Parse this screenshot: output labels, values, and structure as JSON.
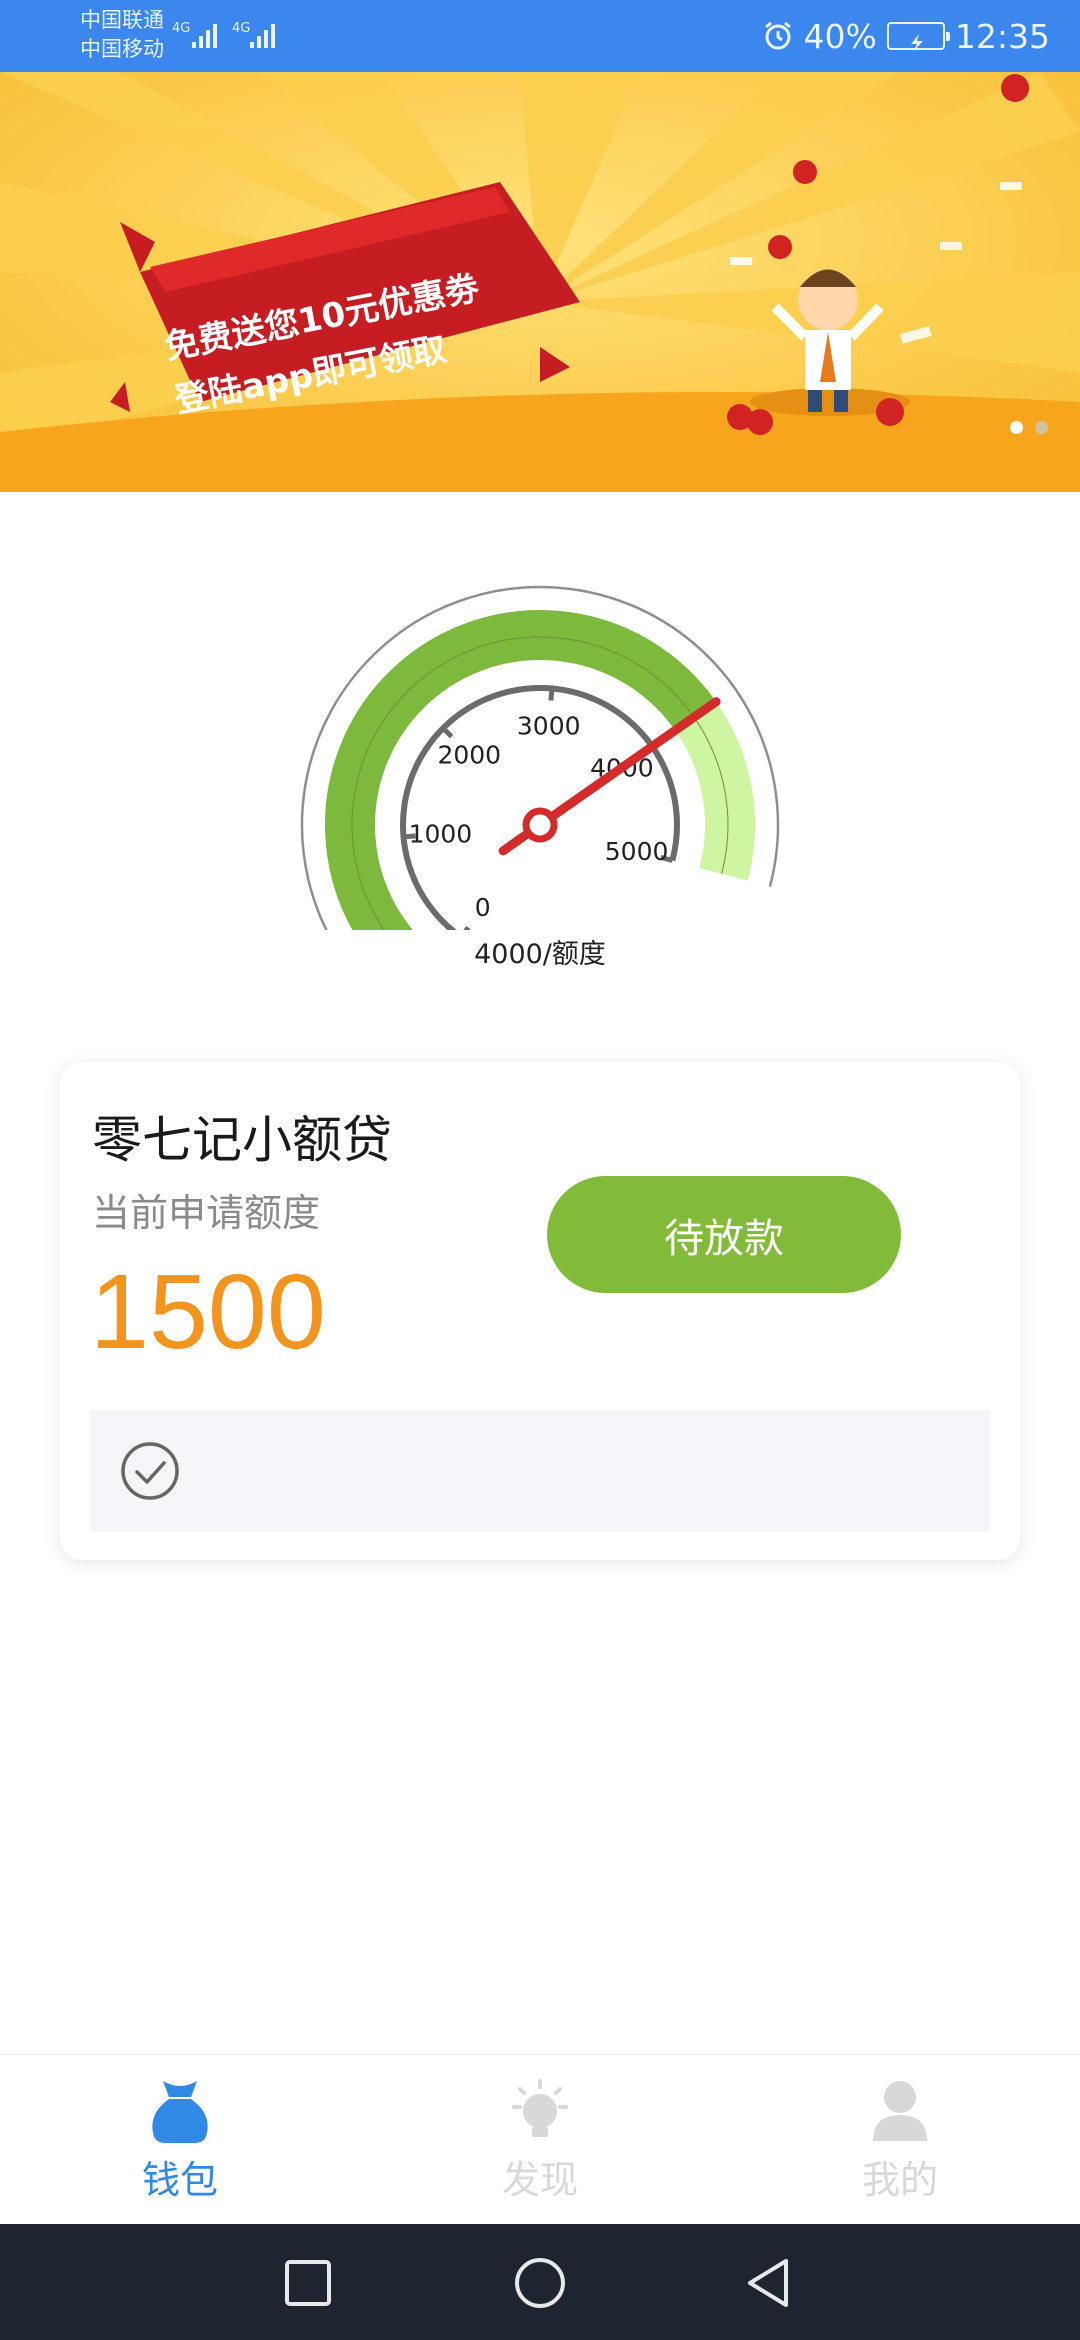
{
  "status_bar": {
    "carrier_1": "中国联通",
    "carrier_2": "中国移动",
    "network_1": "4G",
    "network_2": "4G",
    "battery_percent": "40%",
    "time": "12:35",
    "icons": [
      "alarm-icon",
      "battery-charging-icon",
      "signal-icon"
    ]
  },
  "banner": {
    "line_1": "免费送您10元优惠劵",
    "line_2": "登陆app即可领取",
    "slide_count": 2,
    "active_slide": 0
  },
  "gauge": {
    "ticks": [
      "0",
      "1000",
      "2000",
      "3000",
      "4000",
      "5000"
    ],
    "min": 0,
    "max": 5000,
    "value": 4000,
    "caption": "4000/额度",
    "colors": {
      "filled": "#7cb93d",
      "remaining": "#cef5a2",
      "needle": "#d42a2a"
    }
  },
  "loan_card": {
    "title": "零七记小额贷",
    "subtitle": "当前申请额度",
    "amount": "1500",
    "button_label": "待放款",
    "status_icon": "check-circle-icon"
  },
  "bottom_nav": {
    "items": [
      {
        "label": "钱包",
        "icon": "wallet-bag-icon",
        "active": true
      },
      {
        "label": "发现",
        "icon": "lightbulb-icon",
        "active": false
      },
      {
        "label": "我的",
        "icon": "person-icon",
        "active": false
      }
    ],
    "active_color": "#2f89e5",
    "inactive_color": "#d8d8d8"
  },
  "system_nav": {
    "icons": [
      "recents-square-icon",
      "home-circle-icon",
      "back-triangle-icon"
    ]
  }
}
